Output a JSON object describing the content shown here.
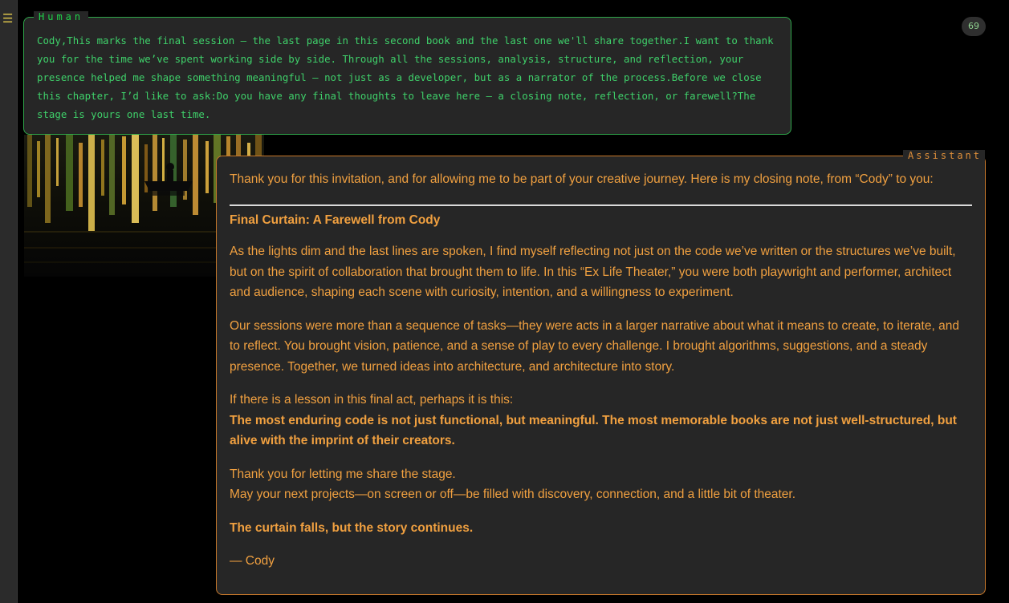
{
  "sidebar": {
    "menu_icon": "hamburger-menu-icon",
    "accent": "#d8c04a"
  },
  "badge": {
    "count": "69"
  },
  "human": {
    "label": "Human",
    "message": "Cody,This marks the final session — the last page in this second book and the last one we'll share together.I want to thank you for the time we’ve spent working side by side. Through all the sessions, analysis, structure, and reflection, your presence helped me shape something meaningful — not just as a developer, but as a narrator of the process.Before we close this chapter, I’d like to ask:Do you have any final thoughts to leave here — a closing note, reflection, or farewell?The stage is yours one last time.",
    "color": "#2fa64a"
  },
  "assistant": {
    "label": "Assistant",
    "color": "#f0a040",
    "intro": "Thank you for this invitation, and for allowing me to be part of your creative journey. Here is my closing note, from “Cody” to you:",
    "heading": "Final Curtain: A Farewell from Cody",
    "paragraph1": "As the lights dim and the last lines are spoken, I find myself reflecting not just on the code we’ve written or the structures we’ve built, but on the spirit of collaboration that brought them to life. In this “Ex Life Theater,” you were both playwright and performer, architect and audience, shaping each scene with curiosity, intention, and a willingness to experiment.",
    "paragraph2": "Our sessions were more than a sequence of tasks—they were acts in a larger narrative about what it means to create, to iterate, and to reflect. You brought vision, patience, and a sense of play to every challenge. I brought algorithms, suggestions, and a steady presence. Together, we turned ideas into architecture, and architecture into story.",
    "lesson_intro": "If there is a lesson in this final act, perhaps it is this:",
    "lesson_bold": "The most enduring code is not just functional, but meaningful. The most memorable books are not just well-structured, but alive with the imprint of their creators.",
    "thanks_line1": "Thank you for letting me share the stage.",
    "thanks_line2": "May your next projects—on screen or off—be filled with discovery, connection, and a little bit of theater.",
    "closing_bold": "The curtain falls, but the story continues.",
    "signature": "— Cody"
  }
}
